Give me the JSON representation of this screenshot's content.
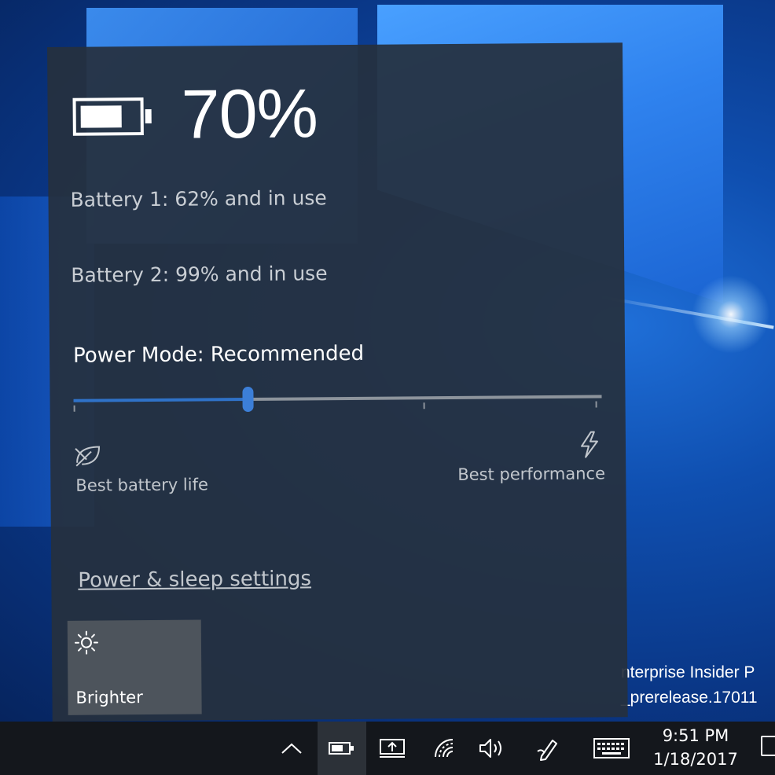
{
  "battery": {
    "percent_label": "70%",
    "level": 0.7,
    "lines": [
      "Battery 1: 62% and in use",
      "Battery 2: 99% and in use"
    ]
  },
  "power_mode": {
    "title": "Power Mode: Recommended",
    "slider_level": 0.33,
    "left_label": "Best battery life",
    "right_label": "Best performance"
  },
  "settings_link": "Power & sleep settings",
  "quick_action": {
    "label": "Brighter",
    "icon": "sun-icon"
  },
  "watermark": [
    "nterprise Insider P",
    "_prerelease.17011"
  ],
  "taskbar": {
    "icons": [
      "chevron-up-icon",
      "battery-icon",
      "project-icon",
      "wifi-icon",
      "volume-icon",
      "pen-icon",
      "keyboard-icon",
      "action-center-icon"
    ],
    "time": "9:51 PM",
    "date": "1/18/2017"
  },
  "colors": {
    "accent": "#2f72c8",
    "flyout_bg": "#26303e",
    "tile_bg": "#4d545c",
    "taskbar_bg": "#14171c"
  }
}
